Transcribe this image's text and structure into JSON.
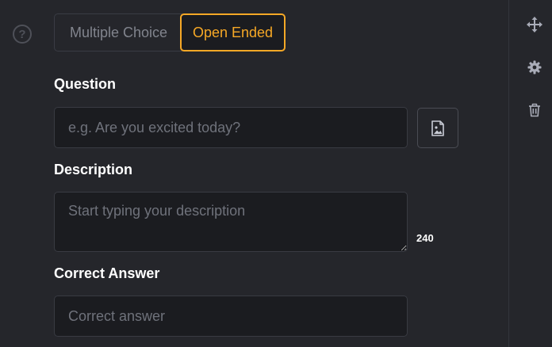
{
  "question_type": {
    "options": [
      "Multiple Choice",
      "Open Ended"
    ],
    "selected": "Open Ended"
  },
  "question": {
    "label": "Question",
    "placeholder": "e.g. Are you excited today?",
    "value": ""
  },
  "description": {
    "label": "Description",
    "placeholder": "Start typing your description",
    "value": "",
    "char_count": "240"
  },
  "correct_answer": {
    "label": "Correct Answer",
    "placeholder": "Correct answer",
    "value": ""
  },
  "icons": {
    "help": "help-circle-icon",
    "image": "image-upload-icon",
    "move": "move-icon",
    "settings": "gear-icon",
    "delete": "trash-icon"
  },
  "colors": {
    "background": "#25262b",
    "input_background": "#1b1c20",
    "accent": "#f6a826",
    "sidebar_icon": "#a9acb8"
  }
}
